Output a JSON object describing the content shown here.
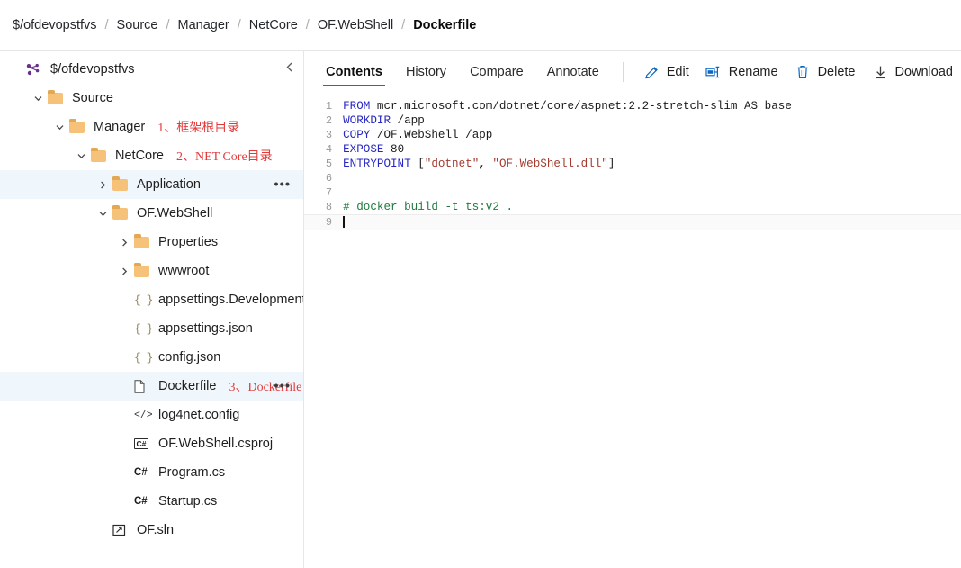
{
  "breadcrumb": {
    "separator": "/",
    "items": [
      {
        "label": "$/ofdevopstfvs",
        "current": false
      },
      {
        "label": "Source",
        "current": false
      },
      {
        "label": "Manager",
        "current": false
      },
      {
        "label": "NetCore",
        "current": false
      },
      {
        "label": "OF.WebShell",
        "current": false
      },
      {
        "label": "Dockerfile",
        "current": true
      }
    ]
  },
  "sidebar": {
    "collapse_icon": "chevron-left-icon",
    "overflow_label": "•••",
    "tree": [
      {
        "label": "$/ofdevopstfvs",
        "icon": "repo-icon",
        "indent": 0,
        "chevron": "none",
        "selected": false,
        "annotation": "",
        "overflow": false
      },
      {
        "label": "Source",
        "icon": "folder-icon",
        "indent": 1,
        "chevron": "expanded",
        "selected": false,
        "annotation": "",
        "overflow": false
      },
      {
        "label": "Manager",
        "icon": "folder-icon",
        "indent": 2,
        "chevron": "expanded",
        "selected": false,
        "annotation": "1、框架根目录",
        "overflow": false
      },
      {
        "label": "NetCore",
        "icon": "folder-icon",
        "indent": 3,
        "chevron": "expanded",
        "selected": false,
        "annotation": "2、NET Core目录",
        "overflow": false
      },
      {
        "label": "Application",
        "icon": "folder-icon",
        "indent": 4,
        "chevron": "collapsed",
        "selected": true,
        "annotation": "",
        "overflow": true
      },
      {
        "label": "OF.WebShell",
        "icon": "folder-icon",
        "indent": 4,
        "chevron": "expanded",
        "selected": false,
        "annotation": "",
        "overflow": false
      },
      {
        "label": "Properties",
        "icon": "folder-icon",
        "indent": 5,
        "chevron": "collapsed",
        "selected": false,
        "annotation": "",
        "overflow": false
      },
      {
        "label": "wwwroot",
        "icon": "folder-icon",
        "indent": 5,
        "chevron": "collapsed",
        "selected": false,
        "annotation": "",
        "overflow": false
      },
      {
        "label": "appsettings.Development.json",
        "icon": "json-icon",
        "indent": 5,
        "chevron": "none",
        "selected": false,
        "annotation": "",
        "overflow": false
      },
      {
        "label": "appsettings.json",
        "icon": "json-icon",
        "indent": 5,
        "chevron": "none",
        "selected": false,
        "annotation": "",
        "overflow": false
      },
      {
        "label": "config.json",
        "icon": "json-icon",
        "indent": 5,
        "chevron": "none",
        "selected": false,
        "annotation": "",
        "overflow": false
      },
      {
        "label": "Dockerfile",
        "icon": "file-icon",
        "indent": 5,
        "chevron": "none",
        "selected": true,
        "annotation": "3、Dockerfile",
        "overflow": true
      },
      {
        "label": "log4net.config",
        "icon": "xml-icon",
        "indent": 5,
        "chevron": "none",
        "selected": false,
        "annotation": "",
        "overflow": false
      },
      {
        "label": "OF.WebShell.csproj",
        "icon": "csproj-icon",
        "indent": 5,
        "chevron": "none",
        "selected": false,
        "annotation": "",
        "overflow": false
      },
      {
        "label": "Program.cs",
        "icon": "cs-icon",
        "indent": 5,
        "chevron": "none",
        "selected": false,
        "annotation": "",
        "overflow": false
      },
      {
        "label": "Startup.cs",
        "icon": "cs-icon",
        "indent": 5,
        "chevron": "none",
        "selected": false,
        "annotation": "",
        "overflow": false
      },
      {
        "label": "OF.sln",
        "icon": "sln-icon",
        "indent": 4,
        "chevron": "none",
        "selected": false,
        "annotation": "",
        "overflow": false
      }
    ]
  },
  "content": {
    "tabs": [
      {
        "label": "Contents",
        "active": true
      },
      {
        "label": "History",
        "active": false
      },
      {
        "label": "Compare",
        "active": false
      },
      {
        "label": "Annotate",
        "active": false
      }
    ],
    "actions": [
      {
        "label": "Edit",
        "icon": "pencil-icon"
      },
      {
        "label": "Rename",
        "icon": "rename-icon"
      },
      {
        "label": "Delete",
        "icon": "trash-icon"
      },
      {
        "label": "Download",
        "icon": "download-icon"
      }
    ],
    "code": {
      "language": "dockerfile",
      "cursor_line": 9,
      "lines": [
        {
          "n": 1,
          "tokens": [
            {
              "t": "FROM",
              "c": "kw"
            },
            {
              "t": " mcr.microsoft.com/dotnet/core/aspnet:2.2-stretch-slim AS base",
              "c": ""
            }
          ]
        },
        {
          "n": 2,
          "tokens": [
            {
              "t": "WORKDIR",
              "c": "kw"
            },
            {
              "t": " /app",
              "c": ""
            }
          ]
        },
        {
          "n": 3,
          "tokens": [
            {
              "t": "COPY",
              "c": "kw"
            },
            {
              "t": " /OF.WebShell /app",
              "c": ""
            }
          ]
        },
        {
          "n": 4,
          "tokens": [
            {
              "t": "EXPOSE",
              "c": "kw"
            },
            {
              "t": " 80",
              "c": ""
            }
          ]
        },
        {
          "n": 5,
          "tokens": [
            {
              "t": "ENTRYPOINT",
              "c": "kw"
            },
            {
              "t": " [",
              "c": ""
            },
            {
              "t": "\"dotnet\"",
              "c": "str"
            },
            {
              "t": ", ",
              "c": ""
            },
            {
              "t": "\"OF.WebShell.dll\"",
              "c": "str"
            },
            {
              "t": "]",
              "c": ""
            }
          ]
        },
        {
          "n": 6,
          "tokens": []
        },
        {
          "n": 7,
          "tokens": []
        },
        {
          "n": 8,
          "tokens": [
            {
              "t": "# docker build -t ts:v2 .",
              "c": "cmt"
            }
          ]
        },
        {
          "n": 9,
          "tokens": []
        }
      ]
    }
  }
}
